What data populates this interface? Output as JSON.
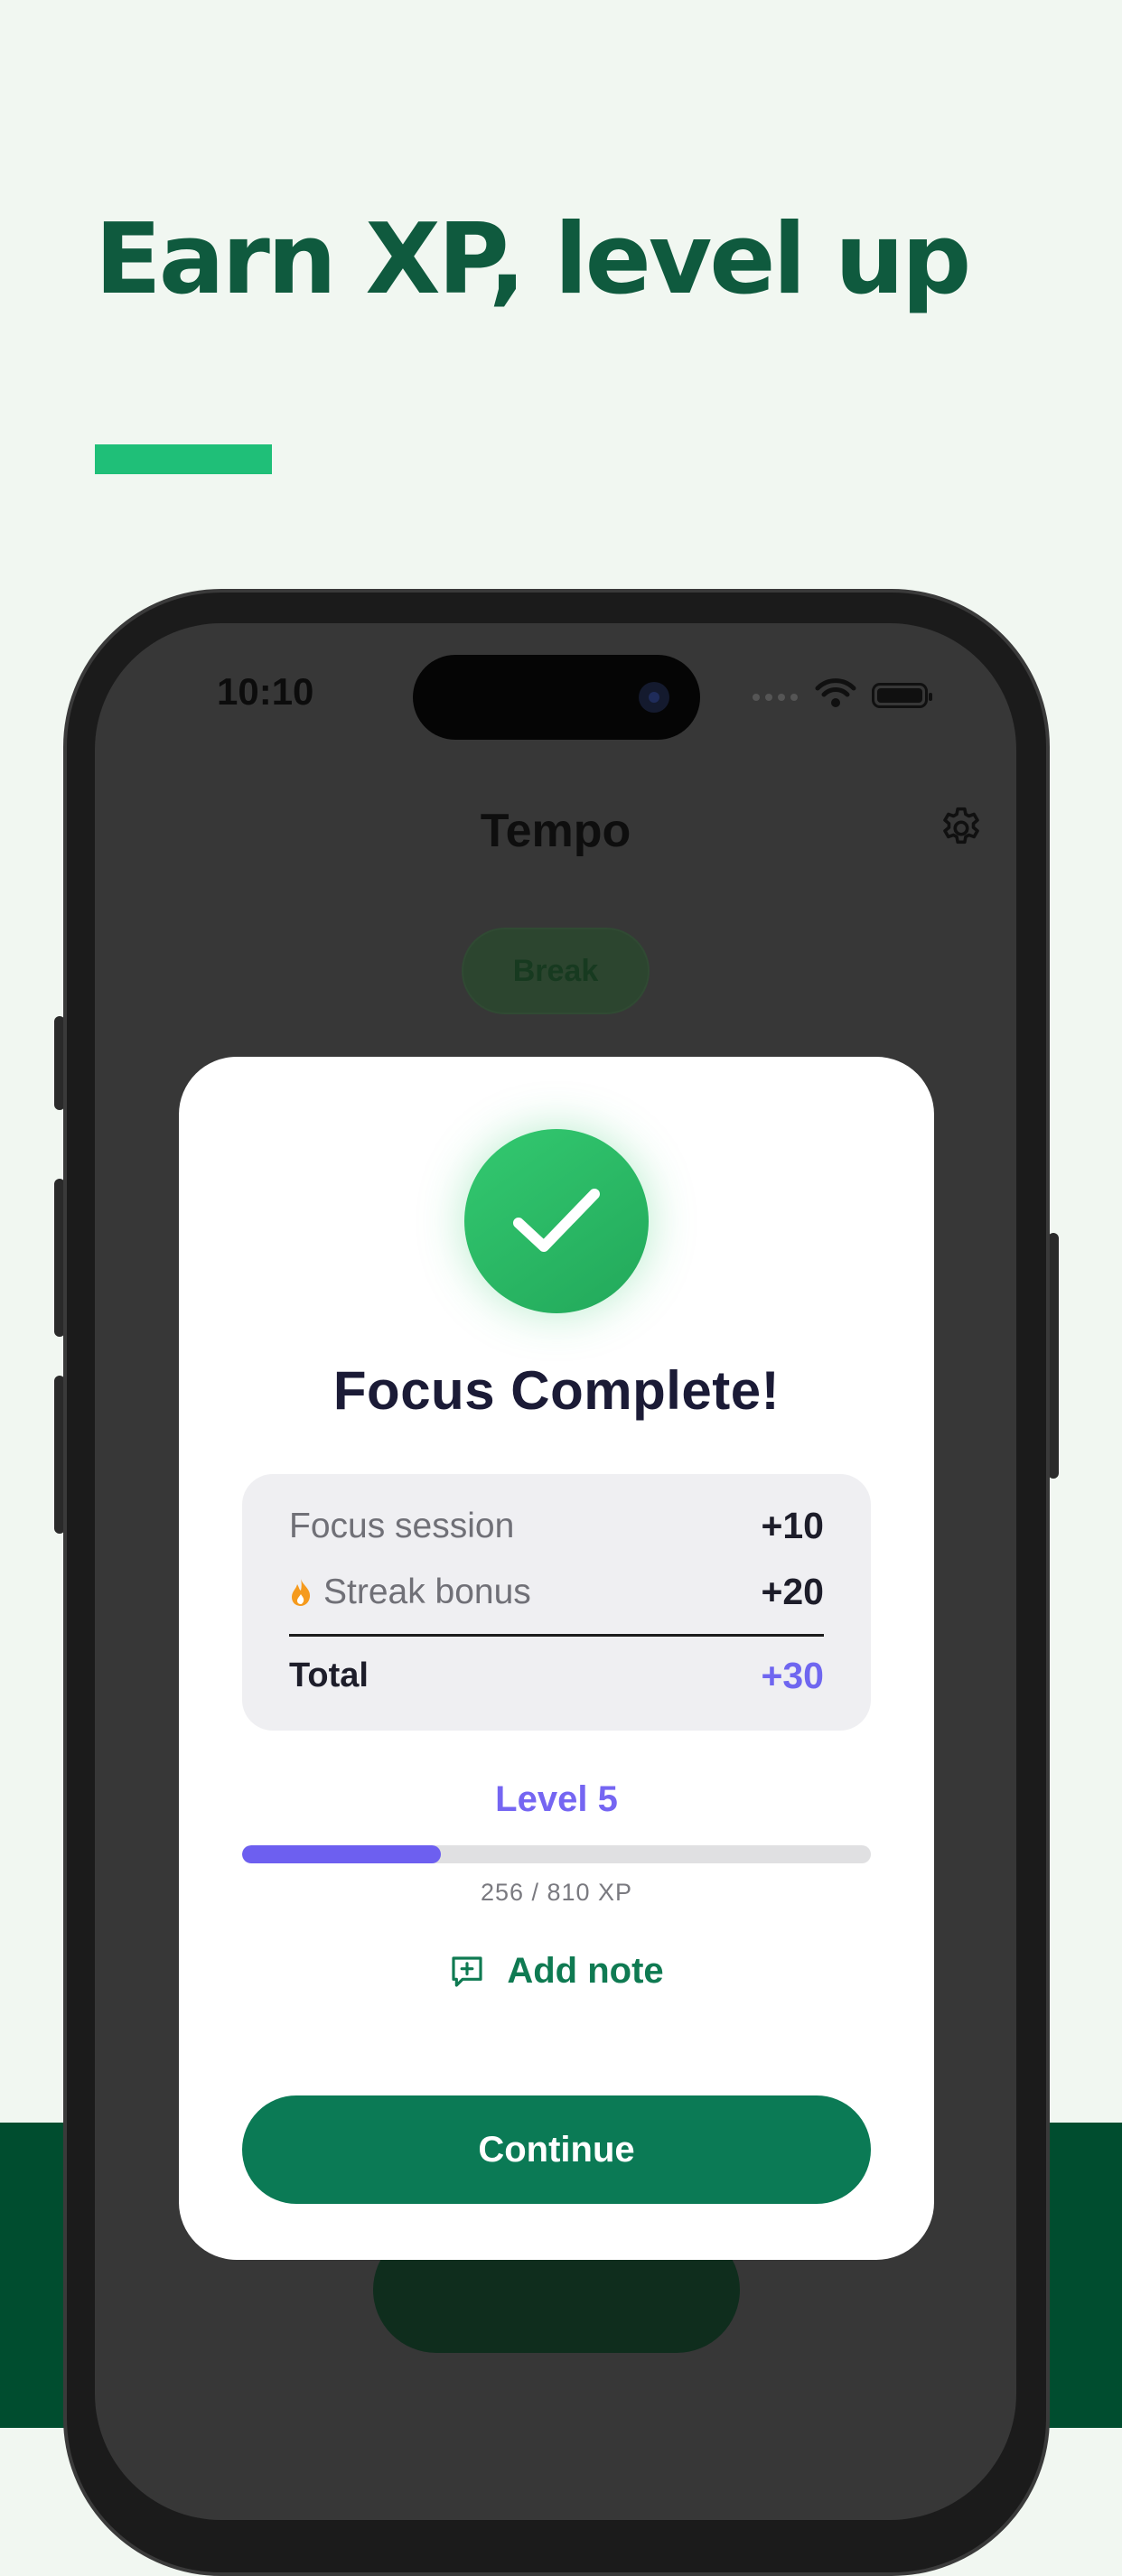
{
  "marketing": {
    "headline": "Earn XP, level up"
  },
  "status_bar": {
    "time": "10:10"
  },
  "app": {
    "title": "Tempo",
    "mode_pill": "Break"
  },
  "modal": {
    "title": "Focus Complete!",
    "rows": [
      {
        "label": "Focus session",
        "value": "+10",
        "icon": null
      },
      {
        "label": "Streak bonus",
        "value": "+20",
        "icon": "flame-icon"
      }
    ],
    "total_label": "Total",
    "total_value": "+30",
    "level_label": "Level 5",
    "xp_current": 256,
    "xp_max": 810,
    "xp_text": "256 / 810 XP",
    "add_note_label": "Add note",
    "continue_label": "Continue"
  },
  "icons": {
    "check": "checkmark-icon",
    "settings": "gear-icon",
    "note": "add-note-icon",
    "streak": "flame-icon"
  },
  "colors": {
    "brand_green": "#0b7a55",
    "accent_green": "#1fbf78",
    "xp_purple": "#6d5ff0",
    "background": "#f1f7f1",
    "bottom_band": "#004d2f"
  }
}
